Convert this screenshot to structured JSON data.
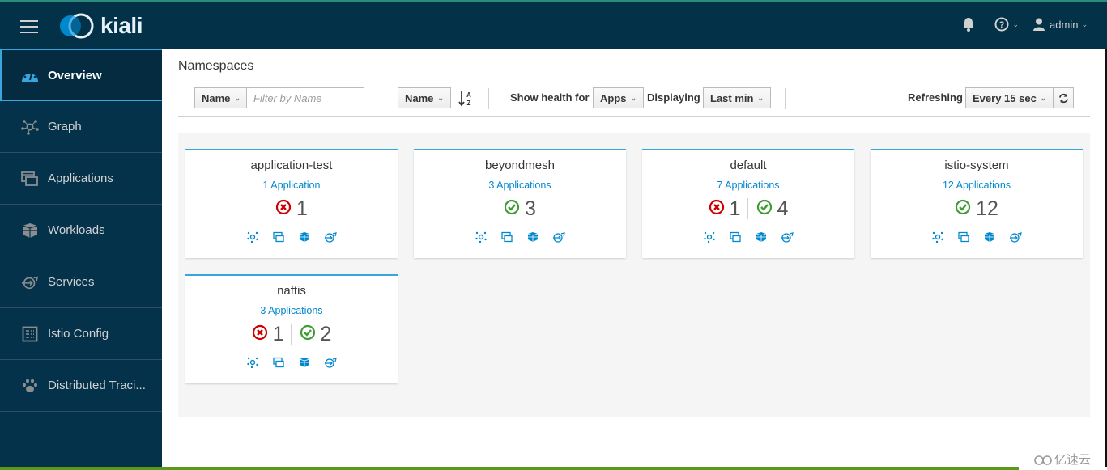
{
  "header": {
    "brand": "kiali",
    "user": "admin"
  },
  "sidebar": {
    "items": [
      {
        "label": "Overview",
        "icon": "tachometer-icon",
        "active": true
      },
      {
        "label": "Graph",
        "icon": "topology-icon"
      },
      {
        "label": "Applications",
        "icon": "applications-icon"
      },
      {
        "label": "Workloads",
        "icon": "workloads-icon"
      },
      {
        "label": "Services",
        "icon": "services-icon"
      },
      {
        "label": "Istio Config",
        "icon": "config-icon"
      },
      {
        "label": "Distributed Traci...",
        "icon": "paw-icon"
      }
    ]
  },
  "page": {
    "title": "Namespaces"
  },
  "toolbar": {
    "filter_field": "Name",
    "filter_placeholder": "Filter by Name",
    "sort_field": "Name",
    "health_label": "Show health for",
    "health_value": "Apps",
    "displaying_label": "Displaying",
    "displaying_value": "Last min",
    "refreshing_label": "Refreshing",
    "refreshing_value": "Every 15 sec"
  },
  "namespaces": [
    {
      "name": "application-test",
      "apps": "1 Application",
      "error": "1",
      "healthy": null
    },
    {
      "name": "beyondmesh",
      "apps": "3 Applications",
      "error": null,
      "healthy": "3"
    },
    {
      "name": "default",
      "apps": "7 Applications",
      "error": "1",
      "healthy": "4"
    },
    {
      "name": "istio-system",
      "apps": "12 Applications",
      "error": null,
      "healthy": "12"
    },
    {
      "name": "naftis",
      "apps": "3 Applications",
      "error": "1",
      "healthy": "2"
    }
  ],
  "colors": {
    "nav_bg": "#03324a",
    "accent": "#39a5dc",
    "link": "#0088ce",
    "error": "#cc0000",
    "ok": "#3f9c35"
  },
  "watermark": "亿速云"
}
